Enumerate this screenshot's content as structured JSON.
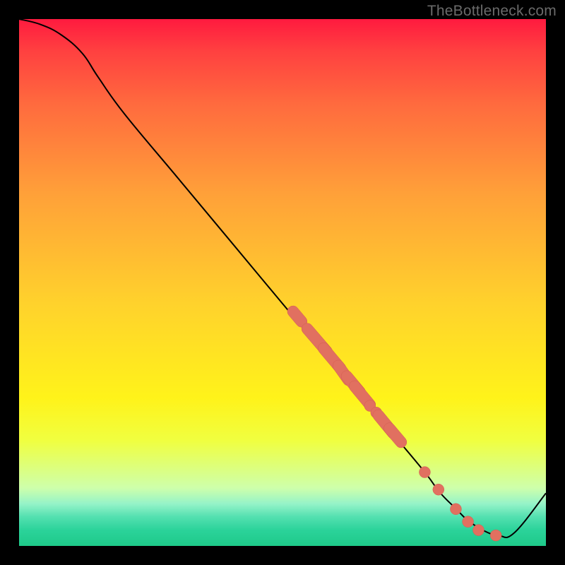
{
  "watermark": "TheBottleneck.com",
  "chart_data": {
    "type": "line",
    "title": "",
    "xlabel": "",
    "ylabel": "",
    "xlim": [
      0,
      100
    ],
    "ylim": [
      0,
      100
    ],
    "grid": false,
    "legend": false,
    "series": [
      {
        "name": "curve",
        "x": [
          0,
          4,
          8,
          12,
          15,
          20,
          30,
          40,
          50,
          58,
          66,
          72,
          77,
          80,
          83,
          85,
          88,
          91,
          94,
          100
        ],
        "y": [
          100,
          99,
          97,
          93.5,
          89,
          82,
          70,
          58,
          46,
          36.5,
          27,
          20,
          14,
          10,
          7,
          5,
          3,
          2,
          2.5,
          10
        ]
      }
    ],
    "markers": [
      {
        "shape": "pill",
        "x0": 52.0,
        "y0": 44.5,
        "x1": 53.6,
        "y1": 42.6
      },
      {
        "shape": "pill",
        "x0": 54.7,
        "y0": 41.2,
        "x1": 58.4,
        "y1": 36.9
      },
      {
        "shape": "pill",
        "x0": 57.8,
        "y0": 37.5,
        "x1": 61.0,
        "y1": 33.7
      },
      {
        "shape": "pill",
        "x0": 60.6,
        "y0": 34.2,
        "x1": 62.5,
        "y1": 31.5
      },
      {
        "shape": "pill",
        "x0": 62.2,
        "y0": 32.2,
        "x1": 64.7,
        "y1": 29.2
      },
      {
        "shape": "pill",
        "x0": 63.7,
        "y0": 30.3,
        "x1": 66.6,
        "y1": 26.8
      },
      {
        "shape": "dot",
        "x": 66.6,
        "y": 26.6
      },
      {
        "shape": "dot",
        "x": 67.8,
        "y": 25.3
      },
      {
        "shape": "pill",
        "x0": 68.2,
        "y0": 24.8,
        "x1": 71.0,
        "y1": 21.4
      },
      {
        "shape": "pill",
        "x0": 70.3,
        "y0": 22.3,
        "x1": 72.5,
        "y1": 19.7
      },
      {
        "shape": "dot",
        "x": 77.0,
        "y": 14.0
      },
      {
        "shape": "dot",
        "x": 79.6,
        "y": 10.7
      },
      {
        "shape": "dot",
        "x": 82.9,
        "y": 7.0
      },
      {
        "shape": "dot",
        "x": 85.2,
        "y": 4.6
      },
      {
        "shape": "dot",
        "x": 87.2,
        "y": 3.0
      },
      {
        "shape": "dot",
        "x": 90.5,
        "y": 2.0
      }
    ],
    "marker_radius": 8
  }
}
